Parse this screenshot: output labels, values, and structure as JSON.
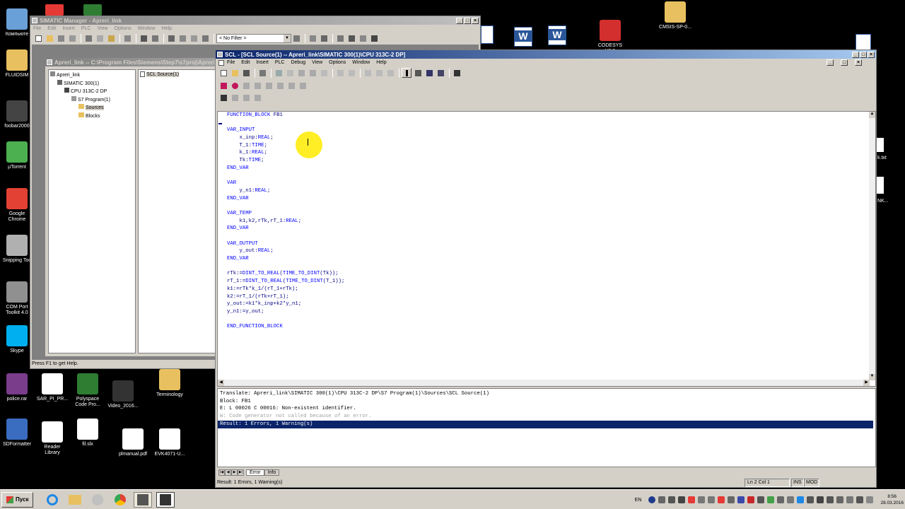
{
  "desktop": {
    "left_icons": [
      {
        "label": "Компьюте",
        "icon": "computer-icon",
        "color": "#6aa0d8"
      },
      {
        "label": "FLUIDSIM",
        "icon": "folder-icon",
        "color": "#e8c060"
      },
      {
        "label": "foobar2000",
        "icon": "foobar-icon",
        "color": "#444444"
      },
      {
        "label": "µTorrent",
        "icon": "utorrent-icon",
        "color": "#4caf50"
      },
      {
        "label": "Google Chrome",
        "icon": "chrome-icon",
        "color": "#e34133"
      },
      {
        "label": "Snipping Too",
        "icon": "scissors-icon",
        "color": "#b0b0b0"
      },
      {
        "label": "COM Port Toolkit 4.0",
        "icon": "plug-icon",
        "color": "#909090"
      },
      {
        "label": "Skype",
        "icon": "skype-icon",
        "color": "#00aff0"
      },
      {
        "label": "police.rar",
        "icon": "rar-icon",
        "color": "#7a3d8c"
      },
      {
        "label": "SDFormatter",
        "icon": "sd-icon",
        "color": "#3a6cc0"
      }
    ],
    "bottom_icons": [
      {
        "label": "SAR_PI_PR...",
        "icon": "document-icon",
        "color": "#ffffff"
      },
      {
        "label": "Polyspace Code Pro...",
        "icon": "polyspace-icon",
        "color": "#2e7d32"
      },
      {
        "label": "Video_2016...",
        "icon": "video-icon",
        "color": "#333333"
      },
      {
        "label": "Terminology",
        "icon": "terminology-icon",
        "color": "#e8c060"
      },
      {
        "label": "Reader Library",
        "icon": "book-icon",
        "color": "#ffffff"
      },
      {
        "label": "fil.slx",
        "icon": "simulink-icon",
        "color": "#ffffff"
      },
      {
        "label": "plmanual.pdf",
        "icon": "pdf-icon",
        "color": "#ffffff"
      },
      {
        "label": "EVK4071-U...",
        "icon": "pdf-icon",
        "color": "#ffffff"
      }
    ],
    "top_icons": [
      {
        "label": "CODESYS V3.5",
        "icon": "codesys-icon",
        "color": "#d32f2f"
      },
      {
        "label": "CMSIS-SP-0...",
        "icon": "folder-icon",
        "color": "#e8c060"
      }
    ],
    "right_labels": [
      "k.txt",
      "NK..."
    ]
  },
  "simatic": {
    "title": "SIMATIC Manager - Apreri_link",
    "menu": [
      "File",
      "Edit",
      "Insert",
      "PLC",
      "View",
      "Options",
      "Window",
      "Help"
    ],
    "filter": "< No Filter >",
    "project_title": "Apreri_link -- C:\\Program Files\\Siemens\\Step7\\s7proj\\Apreri",
    "tree": [
      "Apreri_link",
      "SIMATIC 300(1)",
      "CPU 313C-2 DP",
      "S7 Program(1)",
      "Sources",
      "Blocks"
    ],
    "list_item": "SCL Source(1)",
    "status": "Press F1 to get Help."
  },
  "scl": {
    "title": "SCL - [SCL Source(1) -- Apreri_link\\SIMATIC 300(1)\\CPU 313C-2 DP]",
    "menu": [
      "File",
      "Edit",
      "Insert",
      "PLC",
      "Debug",
      "View",
      "Options",
      "Window",
      "Help"
    ],
    "code_lines": [
      [
        [
          "kw",
          "FUNCTION_BLOCK"
        ],
        [
          "t",
          " FB1"
        ]
      ],
      [],
      [
        [
          "kw",
          "VAR_INPUT"
        ]
      ],
      [
        [
          "t",
          "    x_inp:"
        ],
        [
          "kw",
          "REAL"
        ],
        [
          "t",
          ";"
        ]
      ],
      [
        [
          "t",
          "    T_1:"
        ],
        [
          "kw",
          "TIME"
        ],
        [
          "t",
          ";"
        ]
      ],
      [
        [
          "t",
          "    k_1:"
        ],
        [
          "kw",
          "REAL"
        ],
        [
          "t",
          ";"
        ]
      ],
      [
        [
          "t",
          "    Tk:"
        ],
        [
          "kw",
          "TIME"
        ],
        [
          "t",
          ";"
        ]
      ],
      [
        [
          "kw",
          "END_VAR"
        ]
      ],
      [],
      [
        [
          "kw",
          "VAR"
        ]
      ],
      [
        [
          "t",
          "    y_n1:"
        ],
        [
          "kw",
          "REAL"
        ],
        [
          "t",
          ";"
        ]
      ],
      [
        [
          "kw",
          "END_VAR"
        ]
      ],
      [],
      [
        [
          "kw",
          "VAR_TEMP"
        ]
      ],
      [
        [
          "t",
          "    k1,k2,rTk,rT_1:"
        ],
        [
          "kw",
          "REAL"
        ],
        [
          "t",
          ";"
        ]
      ],
      [
        [
          "kw",
          "END_VAR"
        ]
      ],
      [],
      [
        [
          "kw",
          "VAR_OUTPUT"
        ]
      ],
      [
        [
          "t",
          "    y_out:"
        ],
        [
          "kw",
          "REAL"
        ],
        [
          "t",
          ";"
        ]
      ],
      [
        [
          "kw",
          "END_VAR"
        ]
      ],
      [],
      [
        [
          "t",
          "rTk:="
        ],
        [
          "kw",
          "DINT_TO_REAL"
        ],
        [
          "t",
          "("
        ],
        [
          "kw",
          "TIME_TO_DINT"
        ],
        [
          "t",
          "(Tk));"
        ]
      ],
      [
        [
          "t",
          "rT_1:="
        ],
        [
          "kw",
          "DINT_TO_REAL"
        ],
        [
          "t",
          "("
        ],
        [
          "kw",
          "TIME_TO_DINT"
        ],
        [
          "t",
          "(T_1));"
        ]
      ],
      [
        [
          "t",
          "k1:=rTk*k_1/(rT_1+rTk);"
        ]
      ],
      [
        [
          "t",
          "k2:=rT_1/(rTk+rT_1);"
        ]
      ],
      [
        [
          "t",
          "y_out:=k1*k_inp+k2*y_n1;"
        ]
      ],
      [
        [
          "t",
          "y_n1:=y_out;"
        ]
      ],
      [],
      [
        [
          "kw",
          "END_FUNCTION_BLOCK"
        ]
      ]
    ],
    "output": {
      "line1": "Translate: Apreri_link\\SIMATIC 300(1)\\CPU 313C-2 DP\\S7 Program(1)\\Sources\\SCL Source(1)",
      "line2": "Block: FB1",
      "line3": "E: L 00026 C 00016: Non-existent identifier.",
      "line4": "W: Code generator not called because of an error.",
      "line5": "Result: 1 Errors, 1 Warning(s)"
    },
    "tabs": [
      "Error",
      "Info"
    ],
    "status": {
      "left": "Result: 1 Errors, 1 Warning(s)",
      "pos": "Ln 2 Col 1",
      "ins": "INS",
      "mod": "MOD"
    }
  },
  "taskbar": {
    "start_label": "Пуск",
    "lang": "EN",
    "time": "8:56",
    "date": "28.03.2016"
  }
}
